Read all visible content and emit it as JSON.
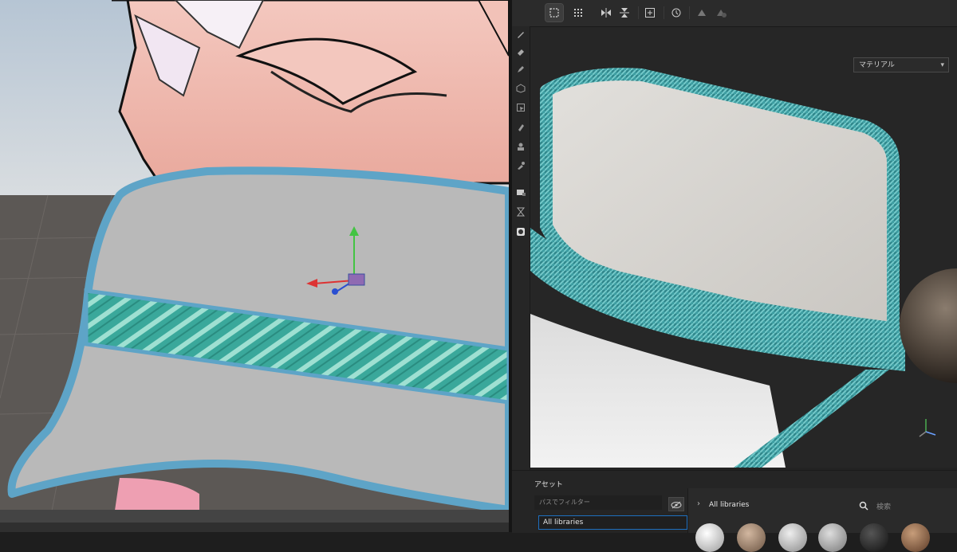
{
  "right_panel": {
    "material_dropdown": {
      "label": "マテリアル"
    }
  },
  "assets": {
    "title": "アセット",
    "filter_placeholder": "パスでフィルター",
    "library_item": "All libraries",
    "library_header": "All libraries",
    "search_placeholder": "検索"
  },
  "colors": {
    "accent_blue": "#1e6fbf",
    "hat_band_teal": "#3fb7a8",
    "hat_trim_blue": "#5fa7c9",
    "hat_body_gray": "#b8b8b8",
    "hair_pink": "#f0b8ac"
  },
  "icons": {
    "toolbar": [
      "grid-select-icon",
      "grid-options-icon",
      "mirror-x-icon",
      "mirror-y-icon",
      "add-frame-icon",
      "history-icon",
      "symmetry-icon",
      "symmetry-off-icon"
    ],
    "side": [
      "brush-icon",
      "eraser-icon",
      "pen-icon",
      "cube-icon",
      "selection-icon",
      "smudge-icon",
      "clone-icon",
      "picker-icon",
      "fill-icon",
      "hourglass-icon",
      "camera-icon"
    ]
  }
}
